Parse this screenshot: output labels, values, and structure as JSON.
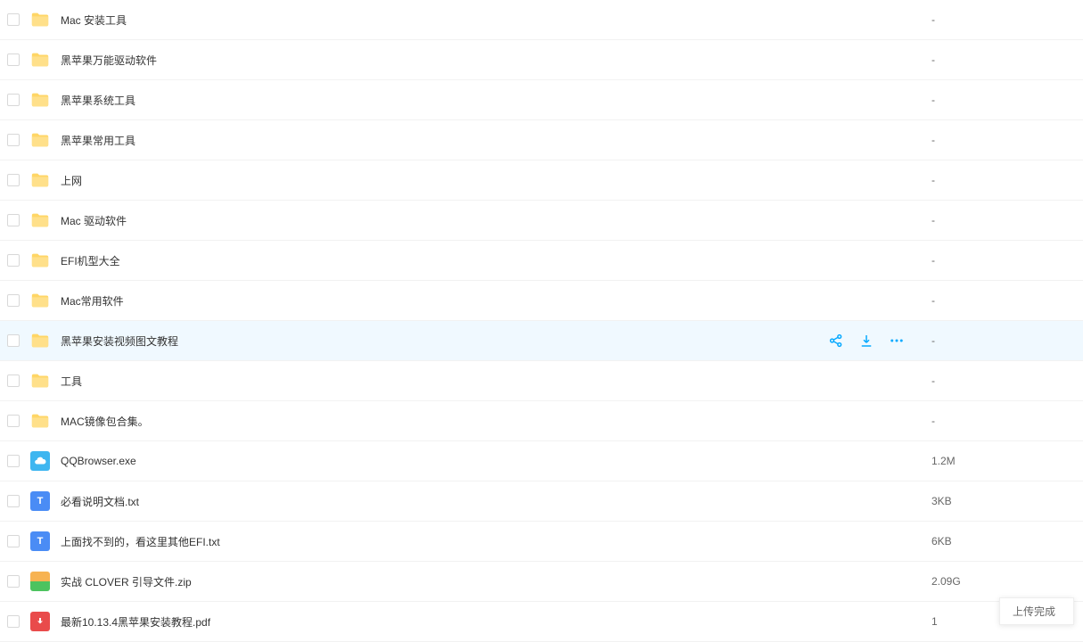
{
  "files": [
    {
      "name": "Mac 安装工具",
      "size": "-",
      "type": "folder"
    },
    {
      "name": "黑苹果万能驱动软件",
      "size": "-",
      "type": "folder"
    },
    {
      "name": "黑苹果系统工具",
      "size": "-",
      "type": "folder"
    },
    {
      "name": "黑苹果常用工具",
      "size": "-",
      "type": "folder"
    },
    {
      "name": "上网",
      "size": "-",
      "type": "folder"
    },
    {
      "name": "Mac 驱动软件",
      "size": "-",
      "type": "folder"
    },
    {
      "name": "EFI机型大全",
      "size": "-",
      "type": "folder"
    },
    {
      "name": "Mac常用软件",
      "size": "-",
      "type": "folder"
    },
    {
      "name": "黑苹果安装视频图文教程",
      "size": "-",
      "type": "folder",
      "hovered": true
    },
    {
      "name": "工具",
      "size": "-",
      "type": "folder"
    },
    {
      "name": "MAC镜像包合集。",
      "size": "-",
      "type": "folder"
    },
    {
      "name": "QQBrowser.exe",
      "size": "1.2M",
      "type": "exe"
    },
    {
      "name": "必看说明文档.txt",
      "size": "3KB",
      "type": "txt"
    },
    {
      "name": "上面找不到的，看这里其他EFI.txt",
      "size": "6KB",
      "type": "txt"
    },
    {
      "name": "实战 CLOVER 引导文件.zip",
      "size": "2.09G",
      "type": "zip"
    },
    {
      "name": "最新10.13.4黑苹果安装教程.pdf",
      "size": "1",
      "type": "pdf"
    }
  ],
  "toast": "上传完成",
  "icons": {
    "share": "share-icon",
    "download": "download-icon",
    "more": "more-icon"
  }
}
